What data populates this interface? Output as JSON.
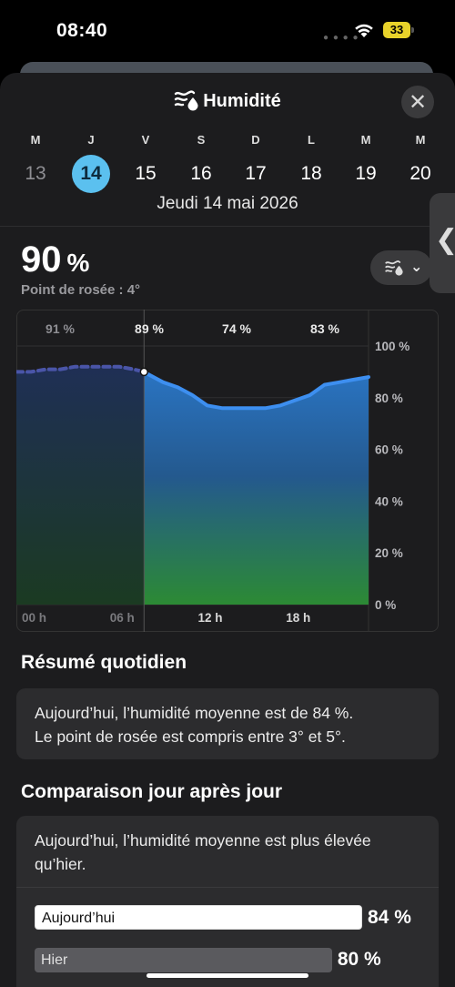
{
  "status": {
    "time": "08:40",
    "battery": "33"
  },
  "header": {
    "title": "Humidité",
    "title_icon": "humidity-icon",
    "close_icon": "close-icon"
  },
  "days": [
    {
      "letter": "M",
      "num": "13"
    },
    {
      "letter": "J",
      "num": "14"
    },
    {
      "letter": "V",
      "num": "15"
    },
    {
      "letter": "S",
      "num": "16"
    },
    {
      "letter": "D",
      "num": "17"
    },
    {
      "letter": "L",
      "num": "18"
    },
    {
      "letter": "M",
      "num": "19"
    },
    {
      "letter": "M",
      "num": "20"
    }
  ],
  "selected_day_index": 1,
  "date_label": "Jeudi 14 mai 2026",
  "current": {
    "value": "90",
    "unit": "%",
    "dew_point": "Point de rosée : 4°"
  },
  "chart_data": {
    "type": "area",
    "x_tick_labels": [
      "00 h",
      "06 h",
      "12 h",
      "18 h"
    ],
    "y_tick_labels": [
      "100 %",
      "80 %",
      "60 %",
      "40 %",
      "20 %",
      "0 %"
    ],
    "ylim": [
      0,
      100
    ],
    "period_labels": [
      "91 %",
      "89 %",
      "74 %",
      "83 %"
    ],
    "now_hour": 8.7,
    "x_hours": [
      0,
      1,
      2,
      3,
      4,
      5,
      6,
      7,
      8,
      8.7,
      9,
      10,
      11,
      12,
      13,
      14,
      15,
      16,
      17,
      18,
      19,
      20,
      21,
      22,
      23,
      24
    ],
    "values": [
      90,
      90,
      91,
      91,
      92,
      92,
      92,
      92,
      91,
      90,
      89,
      86,
      84,
      81,
      77,
      76,
      76,
      76,
      76,
      77,
      79,
      81,
      85,
      86,
      87,
      88
    ],
    "colors": {
      "line": "#3d8ff0",
      "past_line": "#4a55a8",
      "fill_top": "#2a74c2",
      "fill_bottom": "#2c8a34"
    }
  },
  "summary": {
    "title": "Résumé quotidien",
    "line1": "Aujourd’hui, l’humidité moyenne est de 84 %.",
    "line2": "Le point de rosée est compris entre 3° et 5°."
  },
  "comparison": {
    "title": "Comparaison jour après jour",
    "text": "Aujourd’hui, l’humidité moyenne est plus élevée qu’hier.",
    "today_label": "Aujourd’hui",
    "today_value": "84 %",
    "today_pct": 84,
    "yesterday_label": "Hier",
    "yesterday_value": "80 %",
    "yesterday_pct": 80
  }
}
